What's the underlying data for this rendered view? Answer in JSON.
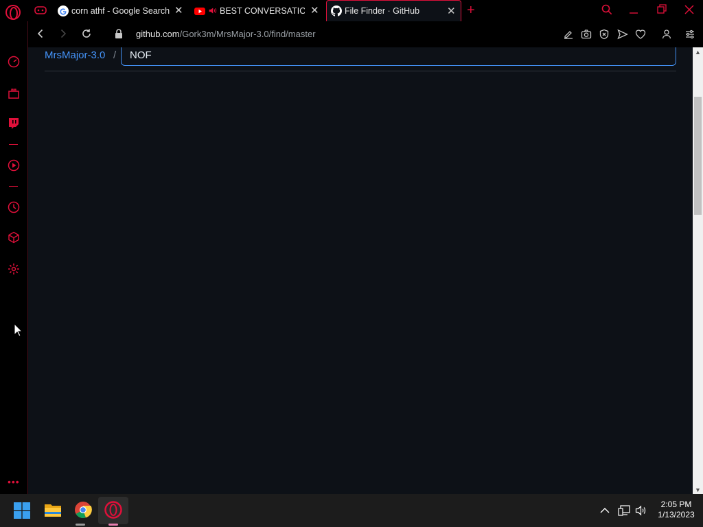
{
  "browser": {
    "tabs": [
      {
        "title": "corn athf - Google Search",
        "favicon": "google-icon"
      },
      {
        "title": "BEST CONVERSATION E",
        "favicon": "youtube-icon",
        "playing": true
      },
      {
        "title": "File Finder · GitHub",
        "favicon": "github-icon",
        "active": true
      }
    ],
    "url_host": "github.com",
    "url_path": "/Gork3m/MrsMajor-3.0/find/master"
  },
  "page": {
    "repo_name": "MrsMajor-3.0",
    "separator": "/",
    "finder_query": "NOF"
  },
  "taskbar": {
    "time": "2:05 PM",
    "date": "1/13/2023",
    "apps": [
      "start-icon",
      "file-explorer-icon",
      "chrome-icon",
      "opera-gx-icon"
    ]
  },
  "colors": {
    "accent": "#e0103a",
    "page_bg": "#0d1117",
    "link": "#4493f8"
  }
}
